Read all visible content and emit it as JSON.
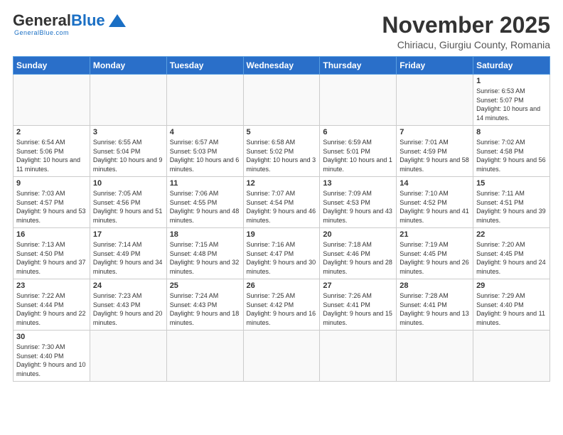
{
  "logo": {
    "general": "General",
    "blue": "Blue",
    "tagline": "GeneralBlue.com"
  },
  "title": "November 2025",
  "location": "Chiriacu, Giurgiu County, Romania",
  "weekdays": [
    "Sunday",
    "Monday",
    "Tuesday",
    "Wednesday",
    "Thursday",
    "Friday",
    "Saturday"
  ],
  "weeks": [
    [
      {
        "day": "",
        "info": ""
      },
      {
        "day": "",
        "info": ""
      },
      {
        "day": "",
        "info": ""
      },
      {
        "day": "",
        "info": ""
      },
      {
        "day": "",
        "info": ""
      },
      {
        "day": "",
        "info": ""
      },
      {
        "day": "1",
        "info": "Sunrise: 6:53 AM\nSunset: 5:07 PM\nDaylight: 10 hours and 14 minutes."
      }
    ],
    [
      {
        "day": "2",
        "info": "Sunrise: 6:54 AM\nSunset: 5:06 PM\nDaylight: 10 hours and 11 minutes."
      },
      {
        "day": "3",
        "info": "Sunrise: 6:55 AM\nSunset: 5:04 PM\nDaylight: 10 hours and 9 minutes."
      },
      {
        "day": "4",
        "info": "Sunrise: 6:57 AM\nSunset: 5:03 PM\nDaylight: 10 hours and 6 minutes."
      },
      {
        "day": "5",
        "info": "Sunrise: 6:58 AM\nSunset: 5:02 PM\nDaylight: 10 hours and 3 minutes."
      },
      {
        "day": "6",
        "info": "Sunrise: 6:59 AM\nSunset: 5:01 PM\nDaylight: 10 hours and 1 minute."
      },
      {
        "day": "7",
        "info": "Sunrise: 7:01 AM\nSunset: 4:59 PM\nDaylight: 9 hours and 58 minutes."
      },
      {
        "day": "8",
        "info": "Sunrise: 7:02 AM\nSunset: 4:58 PM\nDaylight: 9 hours and 56 minutes."
      }
    ],
    [
      {
        "day": "9",
        "info": "Sunrise: 7:03 AM\nSunset: 4:57 PM\nDaylight: 9 hours and 53 minutes."
      },
      {
        "day": "10",
        "info": "Sunrise: 7:05 AM\nSunset: 4:56 PM\nDaylight: 9 hours and 51 minutes."
      },
      {
        "day": "11",
        "info": "Sunrise: 7:06 AM\nSunset: 4:55 PM\nDaylight: 9 hours and 48 minutes."
      },
      {
        "day": "12",
        "info": "Sunrise: 7:07 AM\nSunset: 4:54 PM\nDaylight: 9 hours and 46 minutes."
      },
      {
        "day": "13",
        "info": "Sunrise: 7:09 AM\nSunset: 4:53 PM\nDaylight: 9 hours and 43 minutes."
      },
      {
        "day": "14",
        "info": "Sunrise: 7:10 AM\nSunset: 4:52 PM\nDaylight: 9 hours and 41 minutes."
      },
      {
        "day": "15",
        "info": "Sunrise: 7:11 AM\nSunset: 4:51 PM\nDaylight: 9 hours and 39 minutes."
      }
    ],
    [
      {
        "day": "16",
        "info": "Sunrise: 7:13 AM\nSunset: 4:50 PM\nDaylight: 9 hours and 37 minutes."
      },
      {
        "day": "17",
        "info": "Sunrise: 7:14 AM\nSunset: 4:49 PM\nDaylight: 9 hours and 34 minutes."
      },
      {
        "day": "18",
        "info": "Sunrise: 7:15 AM\nSunset: 4:48 PM\nDaylight: 9 hours and 32 minutes."
      },
      {
        "day": "19",
        "info": "Sunrise: 7:16 AM\nSunset: 4:47 PM\nDaylight: 9 hours and 30 minutes."
      },
      {
        "day": "20",
        "info": "Sunrise: 7:18 AM\nSunset: 4:46 PM\nDaylight: 9 hours and 28 minutes."
      },
      {
        "day": "21",
        "info": "Sunrise: 7:19 AM\nSunset: 4:45 PM\nDaylight: 9 hours and 26 minutes."
      },
      {
        "day": "22",
        "info": "Sunrise: 7:20 AM\nSunset: 4:45 PM\nDaylight: 9 hours and 24 minutes."
      }
    ],
    [
      {
        "day": "23",
        "info": "Sunrise: 7:22 AM\nSunset: 4:44 PM\nDaylight: 9 hours and 22 minutes."
      },
      {
        "day": "24",
        "info": "Sunrise: 7:23 AM\nSunset: 4:43 PM\nDaylight: 9 hours and 20 minutes."
      },
      {
        "day": "25",
        "info": "Sunrise: 7:24 AM\nSunset: 4:43 PM\nDaylight: 9 hours and 18 minutes."
      },
      {
        "day": "26",
        "info": "Sunrise: 7:25 AM\nSunset: 4:42 PM\nDaylight: 9 hours and 16 minutes."
      },
      {
        "day": "27",
        "info": "Sunrise: 7:26 AM\nSunset: 4:41 PM\nDaylight: 9 hours and 15 minutes."
      },
      {
        "day": "28",
        "info": "Sunrise: 7:28 AM\nSunset: 4:41 PM\nDaylight: 9 hours and 13 minutes."
      },
      {
        "day": "29",
        "info": "Sunrise: 7:29 AM\nSunset: 4:40 PM\nDaylight: 9 hours and 11 minutes."
      }
    ],
    [
      {
        "day": "30",
        "info": "Sunrise: 7:30 AM\nSunset: 4:40 PM\nDaylight: 9 hours and 10 minutes."
      },
      {
        "day": "",
        "info": ""
      },
      {
        "day": "",
        "info": ""
      },
      {
        "day": "",
        "info": ""
      },
      {
        "day": "",
        "info": ""
      },
      {
        "day": "",
        "info": ""
      },
      {
        "day": "",
        "info": ""
      }
    ]
  ]
}
